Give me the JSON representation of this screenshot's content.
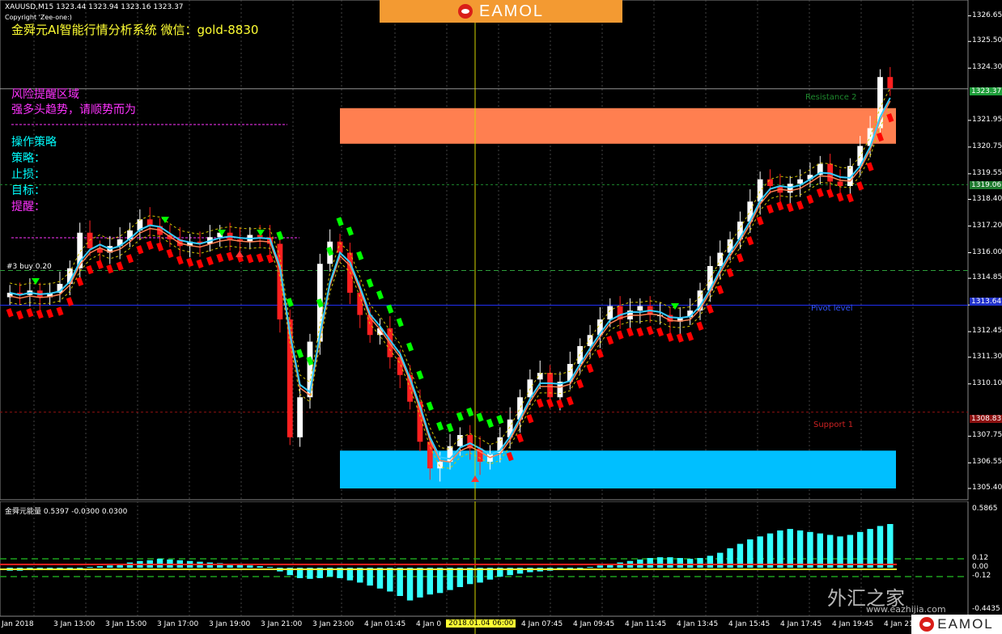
{
  "header": {
    "symbol_line": "XAUUSD,M15  1323.44 1323.94 1323.16 1323.37",
    "copyright": "Copyright 'Zee-one:)",
    "title": "金舜元AI智能行情分析系统  微信：gold-8830"
  },
  "brand": {
    "name": "EAMOL",
    "watermark": "外汇之家",
    "watermark_url": "www.eazhijia.com"
  },
  "info_panel": {
    "risk_title": "风险提醒区域",
    "trend_text": "强多头趋势，请顺势而为",
    "strategy_title": "操作策略",
    "strategy_label": "策略：",
    "stop_label": "止损：",
    "target_label": "目标：",
    "reminder_label": "提醒："
  },
  "chart_labels": {
    "buy_label": "#3 buy 0.20",
    "resistance": "Resistance 2",
    "pivot": "Pivot level",
    "support": "Support 1"
  },
  "price_axis": {
    "ticks": [
      "1326.65",
      "1325.50",
      "1324.30",
      "1321.95",
      "1320.75",
      "1319.55",
      "1318.40",
      "1317.20",
      "1316.00",
      "1314.85",
      "1313.65",
      "1312.45",
      "1311.30",
      "1310.10",
      "1307.75",
      "1306.55",
      "1305.40"
    ],
    "current_price": "1323.37",
    "resistance_price": "1319.06",
    "pivot_price": "1313.64",
    "support_price": "1308.83"
  },
  "time_axis": {
    "labels": [
      "Jan 2018",
      "3 Jan 13:00",
      "3 Jan 15:00",
      "3 Jan 17:00",
      "3 Jan 19:00",
      "3 Jan 21:00",
      "3 Jan 23:00",
      "4 Jan 01:45",
      "4 Jan 0",
      "4 Jan 07:45",
      "4 Jan 09:45",
      "4 Jan 11:45",
      "4 Jan 13:45",
      "4 Jan 15:45",
      "4 Jan 17:45",
      "4 Jan 19:45",
      "4 Jan 21"
    ],
    "cursor_label": "2018.01.04 06:00"
  },
  "oscillator": {
    "title": "金舜元能量 0.5397 -0.0300 0.0300",
    "ticks": [
      "0.5865",
      "0.12",
      "0.00",
      "-0.12",
      "-0.4435"
    ]
  },
  "colors": {
    "resistance_zone": "#ff7f50",
    "support_zone": "#00bfff",
    "bull_candle": "#ffffff",
    "bear_candle": "#ff2020",
    "stop_green": "#00ff00",
    "stop_red": "#ff0000",
    "trend_line": "#33ccff",
    "osc_bar": "#33ffff"
  },
  "chart_data": {
    "type": "candlestick",
    "symbol": "XAUUSD",
    "timeframe": "M15",
    "y_range": [
      1305.0,
      1327.0
    ],
    "levels": {
      "resistance_2": 1319.06,
      "pivot": 1313.64,
      "support_1": 1308.83,
      "current": 1323.37
    },
    "zones": [
      {
        "type": "resistance",
        "from": 1320.9,
        "to": 1322.5
      },
      {
        "type": "support",
        "from": 1305.4,
        "to": 1307.1
      }
    ],
    "close_path": [
      1314.2,
      1314.1,
      1314.3,
      1314.0,
      1314.2,
      1314.6,
      1315.3,
      1316.9,
      1316.2,
      1316.0,
      1316.3,
      1316.6,
      1317.0,
      1317.5,
      1317.2,
      1316.8,
      1316.6,
      1316.3,
      1316.5,
      1316.4,
      1316.7,
      1316.9,
      1316.6,
      1316.5,
      1316.8,
      1316.7,
      1316.4,
      1313.0,
      1307.7,
      1309.5,
      1312.0,
      1315.5,
      1316.5,
      1316.0,
      1314.2,
      1313.2,
      1312.3,
      1312.6,
      1311.3,
      1310.5,
      1309.3,
      1307.5,
      1306.3,
      1306.6,
      1307.3,
      1307.8,
      1307.2,
      1306.6,
      1307.0,
      1307.7,
      1308.5,
      1309.5,
      1310.3,
      1310.6,
      1309.5,
      1310.2,
      1311.0,
      1311.8,
      1312.3,
      1313.0,
      1313.6,
      1313.0,
      1313.4,
      1313.6,
      1313.2,
      1313.2,
      1312.9,
      1313.1,
      1313.4,
      1314.3,
      1315.4,
      1316.0,
      1316.6,
      1317.4,
      1318.3,
      1319.3,
      1319.0,
      1318.7,
      1319.1,
      1319.3,
      1319.5,
      1320.0,
      1319.2,
      1319.0,
      1319.9,
      1320.8,
      1321.6,
      1323.9,
      1323.4
    ],
    "oscillator_values": [
      -0.04,
      -0.04,
      -0.03,
      -0.03,
      -0.02,
      -0.02,
      -0.01,
      0.0,
      0.01,
      0.02,
      0.03,
      0.05,
      0.07,
      0.09,
      0.1,
      0.12,
      0.11,
      0.1,
      0.09,
      0.08,
      0.07,
      0.06,
      0.05,
      0.04,
      0.03,
      0.02,
      0.01,
      -0.05,
      -0.1,
      -0.14,
      -0.15,
      -0.14,
      -0.12,
      -0.14,
      -0.17,
      -0.2,
      -0.24,
      -0.28,
      -0.32,
      -0.38,
      -0.44,
      -0.4,
      -0.36,
      -0.34,
      -0.3,
      -0.26,
      -0.22,
      -0.2,
      -0.16,
      -0.12,
      -0.1,
      -0.08,
      -0.06,
      -0.05,
      -0.04,
      -0.03,
      -0.02,
      0.0,
      0.01,
      0.03,
      0.05,
      0.07,
      0.09,
      0.11,
      0.13,
      0.14,
      0.14,
      0.13,
      0.12,
      0.13,
      0.16,
      0.2,
      0.26,
      0.32,
      0.38,
      0.42,
      0.46,
      0.5,
      0.52,
      0.5,
      0.48,
      0.46,
      0.44,
      0.42,
      0.44,
      0.48,
      0.52,
      0.56,
      0.5865
    ]
  }
}
